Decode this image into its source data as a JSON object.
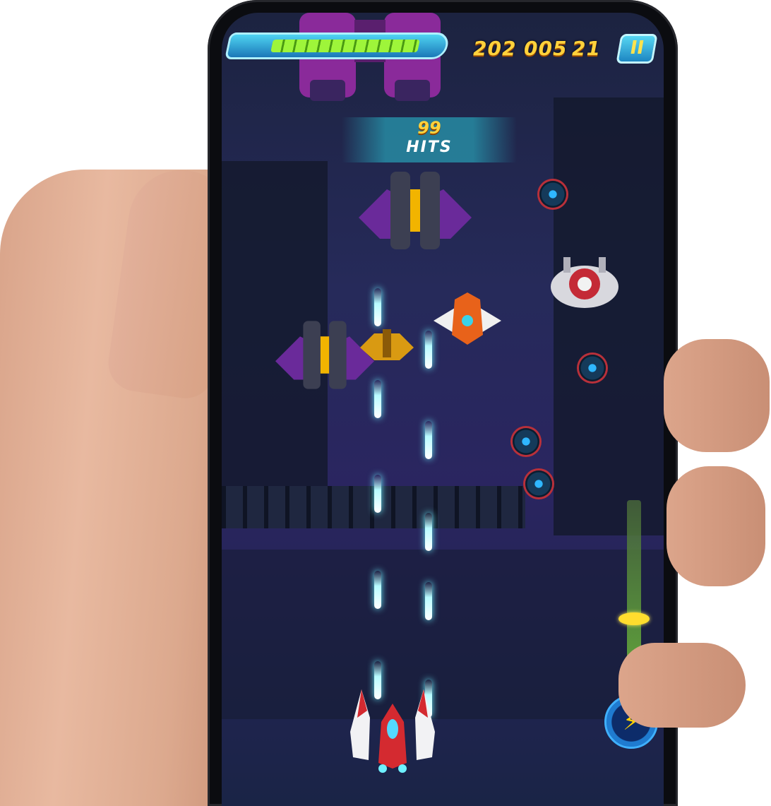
{
  "hud": {
    "health_level_percent": 88,
    "score_part_1": "202",
    "score_part_2": "005",
    "score_part_3": "21",
    "pause_glyph": "II"
  },
  "combo": {
    "count": "99",
    "label": "HITS"
  },
  "controls": {
    "power_level_percent": 30,
    "boost_icon": "lightning-bolt-icon"
  },
  "colors": {
    "score_yellow": "#ffd23c",
    "health_green": "#9ef53a",
    "laser_cyan": "#b8fbff",
    "hud_blue": "#1b78b8"
  }
}
